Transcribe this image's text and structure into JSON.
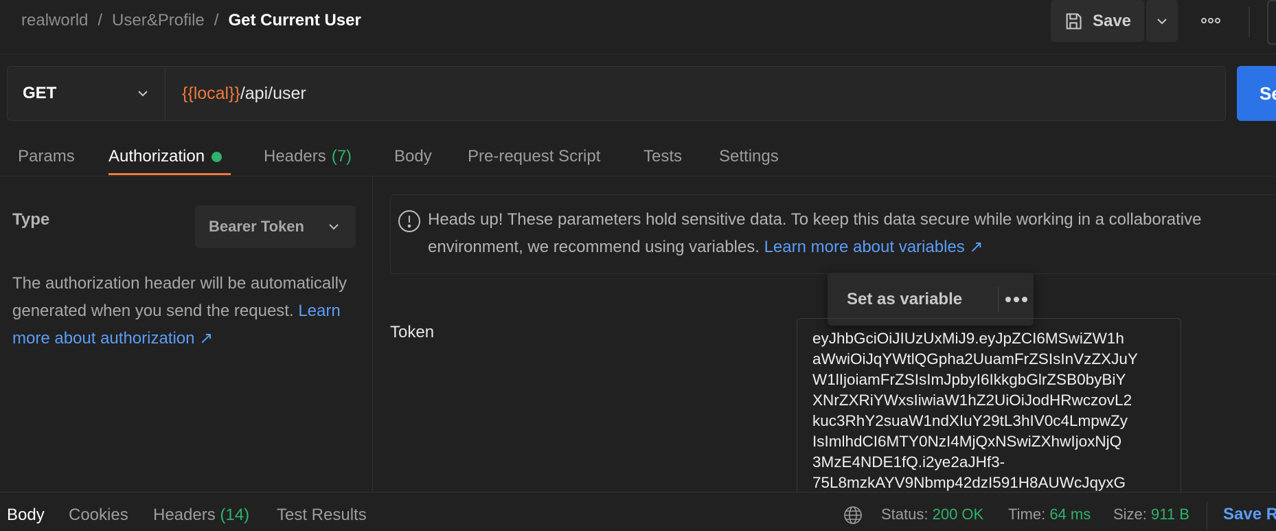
{
  "breadcrumb": {
    "collection": "realworld",
    "folder": "User&Profile",
    "request": "Get Current User",
    "separator": "/"
  },
  "toolbar": {
    "save_label": "Save",
    "save_icon": "floppy-disk-icon",
    "more_icon": "more-horizontal-icon"
  },
  "request": {
    "method": "GET",
    "url_variable": "{{local}}",
    "url_path": "/api/user",
    "send_label": "Se"
  },
  "tabs": [
    {
      "label": "Params"
    },
    {
      "label": "Authorization",
      "active": true,
      "status_dot": true
    },
    {
      "label": "Headers",
      "count": "(7)"
    },
    {
      "label": "Body"
    },
    {
      "label": "Pre-request Script"
    },
    {
      "label": "Tests"
    },
    {
      "label": "Settings"
    }
  ],
  "auth": {
    "type_label": "Type",
    "type_value": "Bearer Token",
    "description": "The authorization header will be automatically generated when you send the request.",
    "link": "Learn more about authorization ↗"
  },
  "notice": {
    "text": "Heads up! These parameters hold sensitive data. To keep this data secure while working in a collaborative environment, we recommend using variables.",
    "link": "Learn more about variables ↗"
  },
  "popup": {
    "label": "Set as variable",
    "more_icon": "more-horizontal-icon"
  },
  "token": {
    "label": "Token",
    "lines": [
      "eyJhbGciOiJIUzUxMiJ9.eyJpZCI6MSwiZW1h",
      "aWwiOiJqYWtlQGpha2UuamFrZSIsInVzZXJuY",
      "W1lIjoiamFrZSIsImJpbyI6IkkgbGlrZSB0byBiY",
      "XNrZXRiYWxsIiwiaW1hZ2UiOiJodHRwczovL2",
      "kuc3RhY2suaW1ndXIuY29tL3hIV0c4LmpwZy",
      "IsImlhdCI6MTY0NzI4MjQxNSwiZXhwIjoxNjQ",
      "3MzE4NDE1fQ.i2ye2aJHf3-",
      "75L8mzkAYV9Nbmp42dzI591H8AUWcJqyxG"
    ]
  },
  "response": {
    "tabs": [
      {
        "label": "Body",
        "active": true
      },
      {
        "label": "Cookies"
      },
      {
        "label": "Headers",
        "count": "(14)"
      },
      {
        "label": "Test Results"
      }
    ],
    "status_label": "Status:",
    "status_value": "200 OK",
    "time_label": "Time:",
    "time_value": "64 ms",
    "size_label": "Size:",
    "size_value": "911 B",
    "save_label": "Save R"
  },
  "colors": {
    "background": "#212121",
    "accent_orange": "#ef7a3c",
    "link_blue": "#5b9df7",
    "success_green": "#2fb26b",
    "send_blue": "#2b73e6"
  }
}
